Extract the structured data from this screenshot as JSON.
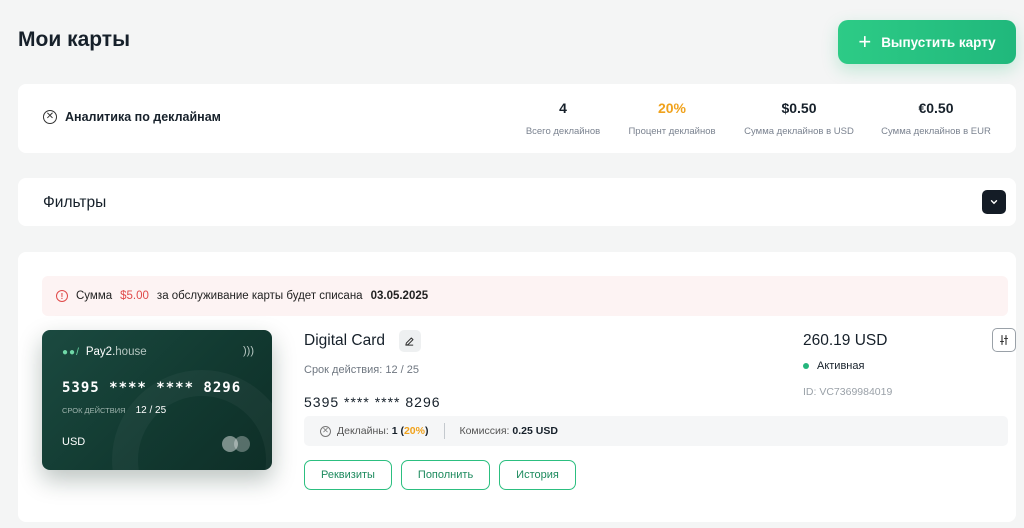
{
  "header": {
    "title": "Мои карты",
    "issue_button_label": "Выпустить карту"
  },
  "analytics": {
    "title": "Аналитика по деклайнам",
    "stats": [
      {
        "value": "4",
        "label": "Всего деклайнов",
        "color": "#16202a"
      },
      {
        "value": "20%",
        "label": "Процент деклайнов",
        "color": "#f0a21c"
      },
      {
        "value": "$0.50",
        "label": "Сумма деклайнов в USD",
        "color": "#16202a"
      },
      {
        "value": "€0.50",
        "label": "Сумма деклайнов в EUR",
        "color": "#16202a"
      }
    ]
  },
  "filters": {
    "title": "Фильтры",
    "toggle_icon": "chevron-down-icon"
  },
  "notice": {
    "prefix": "Сумма",
    "amount": "$5.00",
    "middle": "за обслуживание карты будет списана",
    "date": "03.05.2025"
  },
  "card_visual": {
    "brand_name": "Pay2.",
    "brand_suffix": "house",
    "number": "5395 **** **** 8296",
    "expiry_label": "СРОК ДЕЙСТВИЯ",
    "expiry_value": "12 / 25",
    "currency": "USD",
    "colors": {
      "bg": "#163f36",
      "accent": "#6fd8a8"
    }
  },
  "card_info": {
    "name": "Digital Card",
    "validity_label": "Срок действия:",
    "validity_value": "12 / 25",
    "pan": "5395 **** **** 8296",
    "balance": "260.19 USD",
    "status": "Активная",
    "status_color": "#25b57c",
    "id": "ID: VC7369984019"
  },
  "card_stats": {
    "declines_label": "Деклайны:",
    "declines_count": "1",
    "declines_percent": "20%",
    "commission_label": "Комиссия:",
    "commission_value": "0.25 USD"
  },
  "actions": {
    "details": "Реквизиты",
    "topup": "Пополнить",
    "history": "История"
  },
  "colors": {
    "accent_green": "#2dcb86",
    "warning_orange": "#f0a21c",
    "error_red": "#e04a4a"
  }
}
